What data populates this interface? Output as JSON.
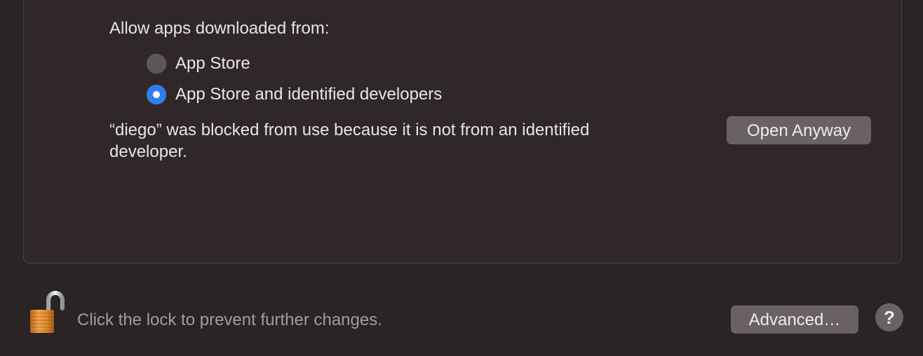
{
  "security": {
    "allow_heading": "Allow apps downloaded from:",
    "options": [
      {
        "label": "App Store",
        "selected": false
      },
      {
        "label": "App Store and identified developers",
        "selected": true
      }
    ],
    "blocked_message": "“diego” was blocked from use because it is not from an identified developer.",
    "open_anyway_label": "Open Anyway"
  },
  "footer": {
    "lock_icon": "unlocked-padlock-icon",
    "lock_text": "Click the lock to prevent further changes.",
    "advanced_label": "Advanced…",
    "help_label": "?"
  },
  "colors": {
    "background": "#2b2424",
    "panel": "#2f2728",
    "accent": "#2f7ef0",
    "button": "#6a6262"
  }
}
